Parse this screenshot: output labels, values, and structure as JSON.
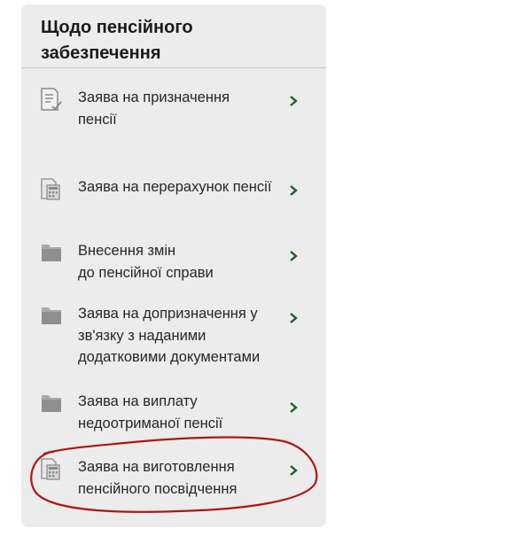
{
  "panel": {
    "title": "Щодо пенсійного\nзабезпечення",
    "accent_color": "#1f5f2a"
  },
  "items": [
    {
      "label": "Заява на призначення\nпенсії",
      "icon": "document-check-icon"
    },
    {
      "label": "Заява на перерахунок пенсії",
      "icon": "document-calculator-icon"
    },
    {
      "label": "Внесення змін\nдо пенсійної справи",
      "icon": "folder-icon"
    },
    {
      "label": "Заява на допризначення у\nзв'язку з наданими\nдодатковими документами",
      "icon": "folder-icon"
    },
    {
      "label": "Заява на виплату\nнедоотриманої пенсії",
      "icon": "folder-icon"
    },
    {
      "label": "Заява на виготовлення\nпенсійного посвідчення",
      "icon": "document-calculator-icon"
    }
  ],
  "annotation_color": "#b01515"
}
